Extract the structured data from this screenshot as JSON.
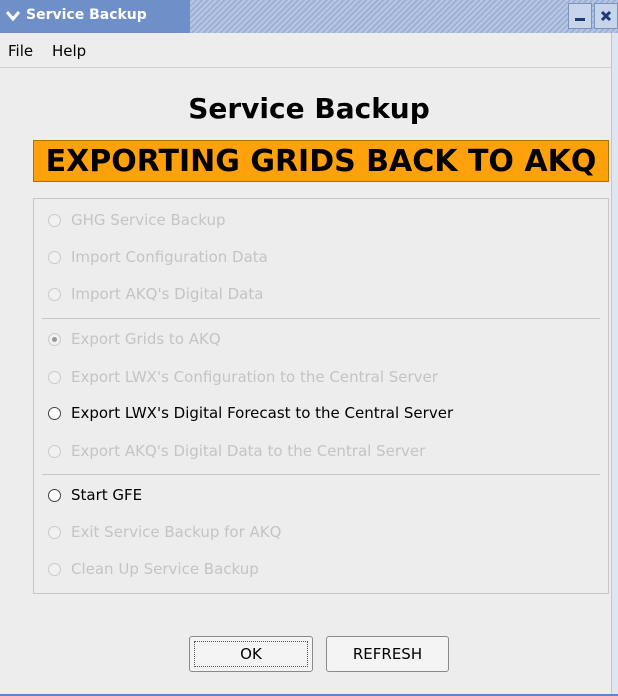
{
  "window": {
    "title": "Service Backup"
  },
  "menu": {
    "items": [
      "File",
      "Help"
    ]
  },
  "header": {
    "title": "Service Backup",
    "status": "EXPORTING GRIDS BACK TO AKQ"
  },
  "options": [
    {
      "label": "GHG Service Backup",
      "enabled": false,
      "selected": false
    },
    {
      "label": "Import Configuration Data",
      "enabled": false,
      "selected": false
    },
    {
      "label": "Import AKQ's Digital Data",
      "enabled": false,
      "selected": false
    },
    {
      "label": "Export Grids to AKQ",
      "enabled": false,
      "selected": true
    },
    {
      "label": "Export LWX's Configuration to the Central Server",
      "enabled": false,
      "selected": false
    },
    {
      "label": "Export LWX's Digital Forecast to the Central Server",
      "enabled": true,
      "selected": false
    },
    {
      "label": "Export AKQ's Digital Data to the Central Server",
      "enabled": false,
      "selected": false
    },
    {
      "label": "Start GFE",
      "enabled": true,
      "selected": false
    },
    {
      "label": "Exit Service Backup for AKQ",
      "enabled": false,
      "selected": false
    },
    {
      "label": "Clean Up Service Backup",
      "enabled": false,
      "selected": false
    }
  ],
  "buttons": {
    "ok": "OK",
    "refresh": "REFRESH"
  },
  "colors": {
    "banner": "#ffa10a",
    "titlebar": "#6e8fc8",
    "disabled_text": "#c4c4c4"
  }
}
